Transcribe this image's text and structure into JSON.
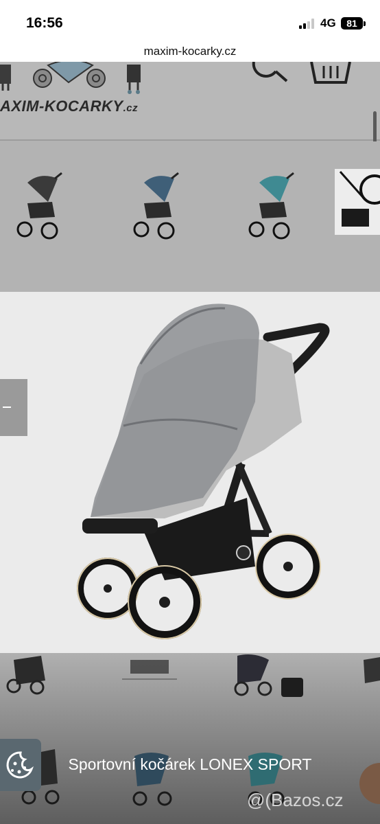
{
  "status_bar": {
    "time": "16:56",
    "network": "4G",
    "battery": "81"
  },
  "browser": {
    "url": "maxim-kocarky.cz"
  },
  "site": {
    "logo_text": "AXIM-KOCARKY",
    "logo_suffix": ".cz",
    "search_icon": "search-icon",
    "cart_icon": "basket-icon"
  },
  "gallery": {
    "thumbnails": [
      "black-stroller",
      "blue-stroller",
      "teal-stroller",
      "detail-photo"
    ],
    "caption": "Sportovní kočárek LONEX SPORT",
    "watermark": "@(Bazos.cz"
  },
  "colors": {
    "overlay_gray": "#b3b3b3",
    "image_bg": "#ebebeb"
  }
}
